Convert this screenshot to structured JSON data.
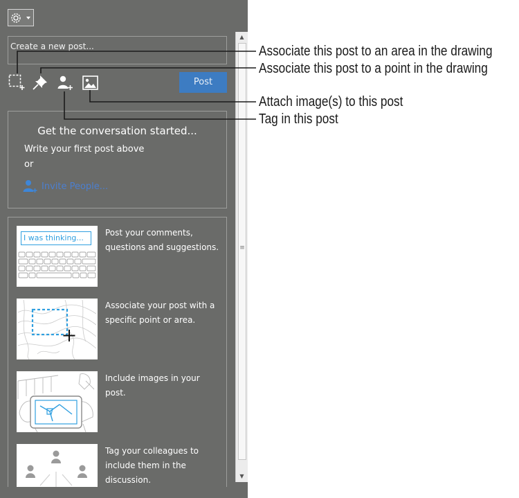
{
  "panel": {
    "composer": {
      "placeholder": "Create a new post..."
    },
    "post_button": "Post",
    "conversation": {
      "title": "Get the conversation started...",
      "line1": "Write your first post above",
      "line2": "or",
      "invite": "Invite People..."
    },
    "tips": [
      {
        "image_text": "I was thinking...",
        "text": "Post your comments, questions and suggestions."
      },
      {
        "text": "Associate your post with a specific point or area."
      },
      {
        "text": "Include images in your post."
      },
      {
        "text": "Tag your colleagues to include them in the discussion."
      }
    ]
  },
  "callouts": [
    "Associate this post to an area in the drawing",
    "Associate this post to a point in the drawing",
    "Attach image(s) to this post",
    "Tag in this post"
  ],
  "colors": {
    "panel": "#6a6b69",
    "post_button": "#3d7cc2",
    "accent": "#2f9fe0",
    "link": "#4c7fcf"
  },
  "icons": [
    "settings-gear-icon",
    "area-select-icon",
    "pushpin-icon",
    "tag-person-icon",
    "image-icon",
    "invite-person-icon"
  ]
}
